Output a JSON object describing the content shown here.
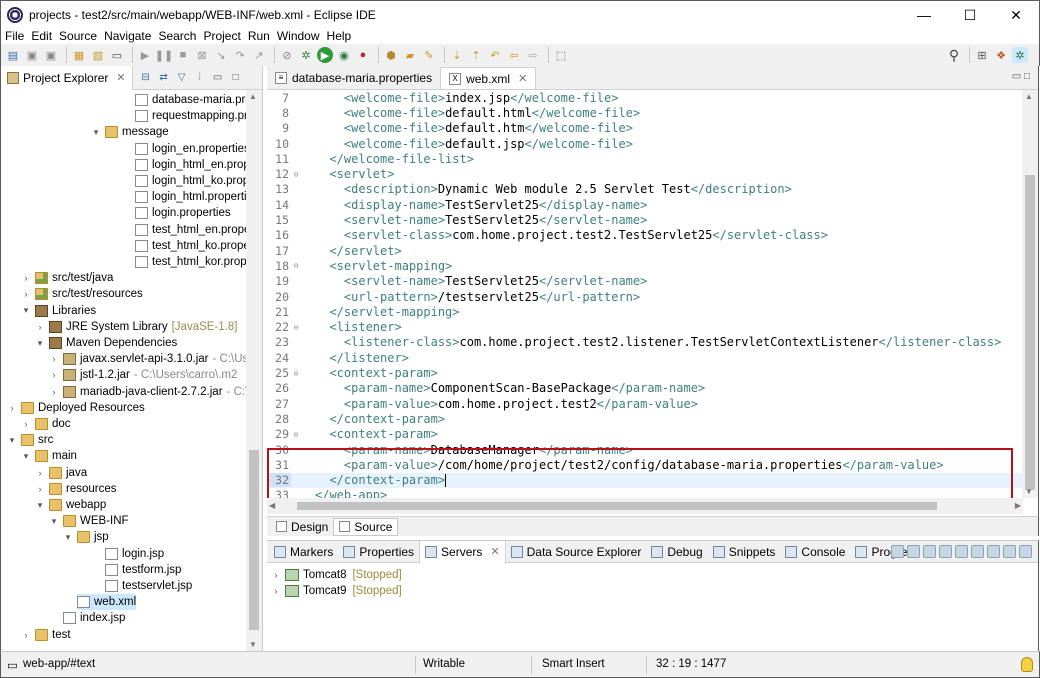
{
  "window": {
    "title": "projects - test2/src/main/webapp/WEB-INF/web.xml - Eclipse IDE",
    "controls": [
      "—",
      "☐",
      "✕"
    ]
  },
  "menu": [
    "File",
    "Edit",
    "Source",
    "Navigate",
    "Search",
    "Project",
    "Run",
    "Window",
    "Help"
  ],
  "project_explorer": {
    "tab_label": "Project Explorer",
    "tab_close": "✕",
    "tree": [
      {
        "label": "database-maria.prop",
        "muted": "",
        "icon": "file",
        "expander": ""
      },
      {
        "label": "requestmapping.pro",
        "muted": "",
        "icon": "file",
        "expander": ""
      },
      {
        "label": "message",
        "muted": "",
        "icon": "folder",
        "expander": "▾"
      },
      {
        "label": "login_en.properties",
        "muted": "",
        "icon": "file",
        "expander": ""
      },
      {
        "label": "login_html_en.prope",
        "muted": "",
        "icon": "file",
        "expander": ""
      },
      {
        "label": "login_html_ko.prope",
        "muted": "",
        "icon": "file",
        "expander": ""
      },
      {
        "label": "login_html.propertie",
        "muted": "",
        "icon": "file",
        "expander": ""
      },
      {
        "label": "login.properties",
        "muted": "",
        "icon": "file",
        "expander": ""
      },
      {
        "label": "test_html_en.propert",
        "muted": "",
        "icon": "file",
        "expander": ""
      },
      {
        "label": "test_html_ko.propert",
        "muted": "",
        "icon": "file",
        "expander": ""
      },
      {
        "label": "test_html_kor.proper",
        "muted": "",
        "icon": "file",
        "expander": ""
      },
      {
        "label": "src/test/java",
        "muted": "",
        "icon": "src",
        "expander": "›"
      },
      {
        "label": "src/test/resources",
        "muted": "",
        "icon": "src",
        "expander": "›"
      },
      {
        "label": "Libraries",
        "muted": "",
        "icon": "lib",
        "expander": "▾"
      },
      {
        "label": "JRE System Library",
        "muted": "[JavaSE-1.8]",
        "icon": "lib",
        "expander": "›"
      },
      {
        "label": "Maven Dependencies",
        "muted": "",
        "icon": "lib",
        "expander": "▾"
      },
      {
        "label": "javax.servlet-api-3.1.0.jar",
        "muted": "- C:\\Us",
        "icon": "jar",
        "expander": "›"
      },
      {
        "label": "jstl-1.2.jar",
        "muted": "- C:\\Users\\carro\\.m2",
        "icon": "jar",
        "expander": "›"
      },
      {
        "label": "mariadb-java-client-2.7.2.jar",
        "muted": "- C:\\U",
        "icon": "jar",
        "expander": "›"
      },
      {
        "label": "Deployed Resources",
        "muted": "",
        "icon": "folder",
        "expander": "›"
      },
      {
        "label": "doc",
        "muted": "",
        "icon": "folder",
        "expander": "›"
      },
      {
        "label": "src",
        "muted": "",
        "icon": "folder",
        "expander": "▾"
      },
      {
        "label": "main",
        "muted": "",
        "icon": "folder",
        "expander": "▾"
      },
      {
        "label": "java",
        "muted": "",
        "icon": "folder",
        "expander": "›"
      },
      {
        "label": "resources",
        "muted": "",
        "icon": "folder",
        "expander": "›"
      },
      {
        "label": "webapp",
        "muted": "",
        "icon": "folder",
        "expander": "▾"
      },
      {
        "label": "WEB-INF",
        "muted": "",
        "icon": "folder",
        "expander": "▾"
      },
      {
        "label": "jsp",
        "muted": "",
        "icon": "folder",
        "expander": "▾"
      },
      {
        "label": "login.jsp",
        "muted": "",
        "icon": "file",
        "expander": ""
      },
      {
        "label": "testform.jsp",
        "muted": "",
        "icon": "file",
        "expander": ""
      },
      {
        "label": "testservlet.jsp",
        "muted": "",
        "icon": "file",
        "expander": ""
      },
      {
        "label": "web.xml",
        "muted": "",
        "icon": "xml",
        "expander": ""
      },
      {
        "label": "index.jsp",
        "muted": "",
        "icon": "file",
        "expander": ""
      },
      {
        "label": "test",
        "muted": "",
        "icon": "folder",
        "expander": "›"
      }
    ]
  },
  "editor": {
    "tabs": [
      {
        "label": "database-maria.properties",
        "close": ""
      },
      {
        "label": "web.xml",
        "close": "✕"
      }
    ],
    "lines": [
      {
        "n": "7",
        "fold": "",
        "indent": "    ",
        "parts": [
          [
            "tag",
            "<welcome-file>"
          ],
          [
            "txt",
            "index.jsp"
          ],
          [
            "tag",
            "</welcome-file>"
          ]
        ]
      },
      {
        "n": "8",
        "fold": "",
        "indent": "    ",
        "parts": [
          [
            "tag",
            "<welcome-file>"
          ],
          [
            "txt",
            "default.html"
          ],
          [
            "tag",
            "</welcome-file>"
          ]
        ]
      },
      {
        "n": "9",
        "fold": "",
        "indent": "    ",
        "parts": [
          [
            "tag",
            "<welcome-file>"
          ],
          [
            "txt",
            "default.htm"
          ],
          [
            "tag",
            "</welcome-file>"
          ]
        ]
      },
      {
        "n": "10",
        "fold": "",
        "indent": "    ",
        "parts": [
          [
            "tag",
            "<welcome-file>"
          ],
          [
            "txt",
            "default.jsp"
          ],
          [
            "tag",
            "</welcome-file>"
          ]
        ]
      },
      {
        "n": "11",
        "fold": "",
        "indent": "  ",
        "parts": [
          [
            "tag",
            "</welcome-file-list>"
          ]
        ]
      },
      {
        "n": "12",
        "fold": "⊖",
        "indent": "  ",
        "parts": [
          [
            "tag",
            "<servlet>"
          ]
        ]
      },
      {
        "n": "13",
        "fold": "",
        "indent": "    ",
        "parts": [
          [
            "tag",
            "<description>"
          ],
          [
            "txt",
            "Dynamic Web module 2.5 Servlet Test"
          ],
          [
            "tag",
            "</description>"
          ]
        ]
      },
      {
        "n": "14",
        "fold": "",
        "indent": "    ",
        "parts": [
          [
            "tag",
            "<display-name>"
          ],
          [
            "txt",
            "TestServlet25"
          ],
          [
            "tag",
            "</display-name>"
          ]
        ]
      },
      {
        "n": "15",
        "fold": "",
        "indent": "    ",
        "parts": [
          [
            "tag",
            "<servlet-name>"
          ],
          [
            "txt",
            "TestServlet25"
          ],
          [
            "tag",
            "</servlet-name>"
          ]
        ]
      },
      {
        "n": "16",
        "fold": "",
        "indent": "    ",
        "parts": [
          [
            "tag",
            "<servlet-class>"
          ],
          [
            "txt",
            "com.home.project.test2.TestServlet25"
          ],
          [
            "tag",
            "</servlet-class>"
          ]
        ]
      },
      {
        "n": "17",
        "fold": "",
        "indent": "  ",
        "parts": [
          [
            "tag",
            "</servlet>"
          ]
        ]
      },
      {
        "n": "18",
        "fold": "⊖",
        "indent": "  ",
        "parts": [
          [
            "tag",
            "<servlet-mapping>"
          ]
        ]
      },
      {
        "n": "19",
        "fold": "",
        "indent": "    ",
        "parts": [
          [
            "tag",
            "<servlet-name>"
          ],
          [
            "txt",
            "TestServlet25"
          ],
          [
            "tag",
            "</servlet-name>"
          ]
        ]
      },
      {
        "n": "20",
        "fold": "",
        "indent": "    ",
        "parts": [
          [
            "tag",
            "<url-pattern>"
          ],
          [
            "txt",
            "/testservlet25"
          ],
          [
            "tag",
            "</url-pattern>"
          ]
        ]
      },
      {
        "n": "21",
        "fold": "",
        "indent": "  ",
        "parts": [
          [
            "tag",
            "</servlet-mapping>"
          ]
        ]
      },
      {
        "n": "22",
        "fold": "⊖",
        "indent": "  ",
        "parts": [
          [
            "tag",
            "<listener>"
          ]
        ]
      },
      {
        "n": "23",
        "fold": "",
        "indent": "    ",
        "parts": [
          [
            "tag",
            "<listener-class>"
          ],
          [
            "txt",
            "com.home.project.test2.listener.TestServletContextListener"
          ],
          [
            "tag",
            "</listener-class>"
          ]
        ]
      },
      {
        "n": "24",
        "fold": "",
        "indent": "  ",
        "parts": [
          [
            "tag",
            "</listener>"
          ]
        ]
      },
      {
        "n": "25",
        "fold": "⊖",
        "indent": "  ",
        "parts": [
          [
            "tag",
            "<context-param>"
          ]
        ]
      },
      {
        "n": "26",
        "fold": "",
        "indent": "    ",
        "parts": [
          [
            "tag",
            "<param-name>"
          ],
          [
            "txt",
            "ComponentScan-BasePackage"
          ],
          [
            "tag",
            "</param-name>"
          ]
        ]
      },
      {
        "n": "27",
        "fold": "",
        "indent": "    ",
        "parts": [
          [
            "tag",
            "<param-value>"
          ],
          [
            "txt",
            "com.home.project.test2"
          ],
          [
            "tag",
            "</param-value>"
          ]
        ]
      },
      {
        "n": "28",
        "fold": "",
        "indent": "  ",
        "parts": [
          [
            "tag",
            "</context-param>"
          ]
        ]
      },
      {
        "n": "29",
        "fold": "⊖",
        "indent": "  ",
        "parts": [
          [
            "tag",
            "<context-param>"
          ]
        ]
      },
      {
        "n": "30",
        "fold": "",
        "indent": "    ",
        "parts": [
          [
            "tag",
            "<param-name>"
          ],
          [
            "txt",
            "DatabaseManager"
          ],
          [
            "tag",
            "</param-name>"
          ]
        ]
      },
      {
        "n": "31",
        "fold": "",
        "indent": "    ",
        "parts": [
          [
            "tag",
            "<param-value>"
          ],
          [
            "txt",
            "/com/home/project/test2/config/database-maria.properties"
          ],
          [
            "tag",
            "</param-value>"
          ]
        ]
      },
      {
        "n": "32",
        "fold": "",
        "indent": "  ",
        "parts": [
          [
            "tag",
            "</context-param>"
          ]
        ],
        "current": true
      },
      {
        "n": "33",
        "fold": "",
        "indent": "",
        "parts": [
          [
            "tag",
            "</web-app>"
          ]
        ]
      }
    ],
    "design_tab": "Design",
    "source_tab": "Source"
  },
  "bottom_panel": {
    "tabs": [
      "Markers",
      "Properties",
      "Servers",
      "Data Source Explorer",
      "Debug",
      "Snippets",
      "Console",
      "Progress"
    ],
    "active_tab": "Servers",
    "servers_close": "✕",
    "servers": [
      {
        "name": "Tomcat8",
        "status": "[Stopped]"
      },
      {
        "name": "Tomcat9",
        "status": "[Stopped]"
      }
    ]
  },
  "statusbar": {
    "path": "web-app/#text",
    "mode": "Writable",
    "insert": "Smart Insert",
    "position": "32 : 19 : 1477"
  },
  "colors": {
    "highlight_border": "#b3141a",
    "xml_tag": "#3f7f7f",
    "selection": "#cce8ff"
  }
}
